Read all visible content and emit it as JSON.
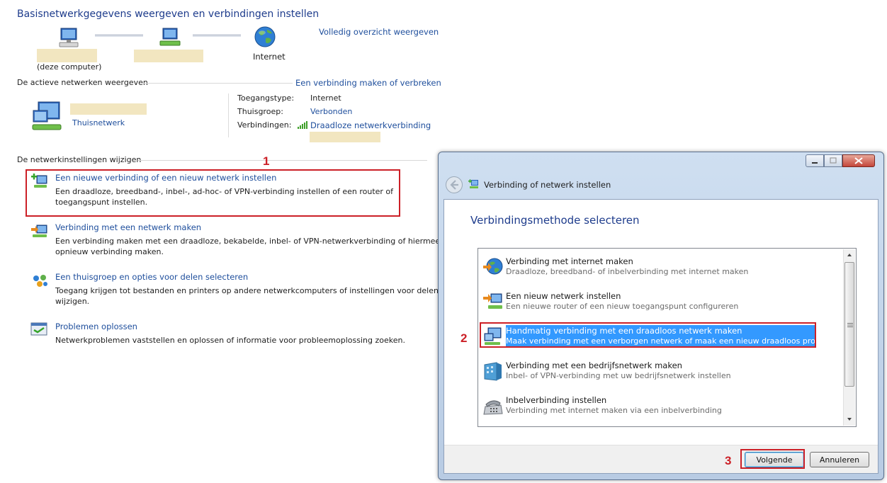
{
  "page": {
    "title": "Basisnetwerkgegevens weergeven en verbindingen instellen",
    "full_map_link": "Volledig overzicht weergeven",
    "this_computer_label": "(deze computer)",
    "internet_label": "Internet"
  },
  "active_networks": {
    "heading": "De actieve netwerken weergeven",
    "connect_link": "Een verbinding maken of verbreken",
    "network_type": "Thuisnetwerk",
    "access_type_label": "Toegangstype:",
    "access_type_value": "Internet",
    "homegroup_label": "Thuisgroep:",
    "homegroup_value": "Verbonden",
    "connections_label": "Verbindingen:",
    "connections_value": "Draadloze netwerkverbinding"
  },
  "change_settings": {
    "heading": "De netwerkinstellingen wijzigen",
    "tasks": [
      {
        "title": "Een nieuwe verbinding of een nieuw netwerk instellen",
        "desc1": "Een draadloze, breedband-, inbel-, ad-hoc- of VPN-verbinding instellen of een router of",
        "desc2": "toegangspunt instellen."
      },
      {
        "title": "Verbinding met een netwerk maken",
        "desc1": "Een verbinding maken met een draadloze, bekabelde, inbel- of VPN-netwerkverbinding of hiermee",
        "desc2": "opnieuw verbinding maken."
      },
      {
        "title": "Een thuisgroep en opties voor delen selecteren",
        "desc1": "Toegang krijgen tot bestanden en printers op andere netwerkcomputers of instellingen voor delen",
        "desc2": "wijzigen."
      },
      {
        "title": "Problemen oplossen",
        "desc1": "Netwerkproblemen vaststellen en oplossen of informatie voor probleemoplossing zoeken.",
        "desc2": ""
      }
    ]
  },
  "dialog": {
    "title": "Verbinding of netwerk instellen",
    "heading": "Verbindingsmethode selecteren",
    "options": [
      {
        "title": "Verbinding met internet maken",
        "desc": "Draadloze, breedband- of inbelverbinding met internet maken"
      },
      {
        "title": "Een nieuw netwerk instellen",
        "desc": "Een nieuwe router of een nieuw toegangspunt configureren"
      },
      {
        "title": "Handmatig verbinding met een draadloos netwerk maken",
        "desc": "Maak verbinding met een verborgen netwerk of maak een nieuw draadloos profiel."
      },
      {
        "title": "Verbinding met een bedrijfsnetwerk maken",
        "desc": "Inbel- of VPN-verbinding met uw bedrijfsnetwerk instellen"
      },
      {
        "title": "Inbelverbinding instellen",
        "desc": "Verbinding met internet maken via een inbelverbinding"
      }
    ],
    "next_button": "Volgende",
    "cancel_button": "Annuleren"
  },
  "annotations": {
    "step1": "1",
    "step2": "2",
    "step3": "3"
  },
  "colors": {
    "link": "#1e4e9c",
    "heading": "#1e3c8c",
    "annotation_red": "#cc2027",
    "selection": "#3399ff"
  }
}
